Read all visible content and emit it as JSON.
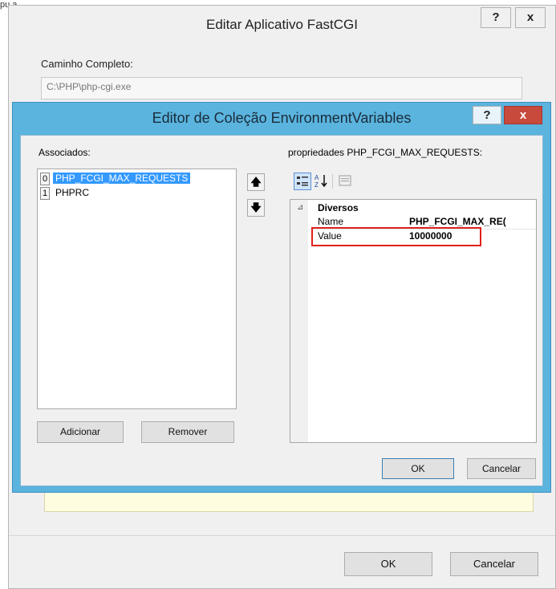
{
  "stray_text": "pu.a ... ... ...",
  "outer": {
    "title": "Editar Aplicativo FastCGI",
    "help_button": "?",
    "close_button": "x",
    "full_path_label": "Caminho Completo:",
    "full_path_value": "C:\\PHP\\php-cgi.exe",
    "ok_label": "OK",
    "cancel_label": "Cancelar"
  },
  "dialog": {
    "title": "Editor de Coleção EnvironmentVariables",
    "help_button": "?",
    "close_button": "x",
    "members_label": "Associados:",
    "members": [
      {
        "index": "0",
        "name": "PHP_FCGI_MAX_REQUESTS",
        "selected": true
      },
      {
        "index": "1",
        "name": "PHPRC",
        "selected": false
      }
    ],
    "move_up_icon": "arrow-up-icon",
    "move_down_icon": "arrow-down-icon",
    "add_label": "Adicionar",
    "remove_label": "Remover",
    "properties_label": "propriedades PHP_FCGI_MAX_REQUESTS:",
    "category_glyph": "⊿",
    "category": "Diversos",
    "properties": [
      {
        "name": "Name",
        "value": "PHP_FCGI_MAX_RE("
      },
      {
        "name": "Value",
        "value": "10000000"
      }
    ],
    "ok_label": "OK",
    "cancel_label": "Cancelar"
  },
  "colors": {
    "dialog_frame": "#5ab4de",
    "selection": "#3399ff",
    "close_red": "#c74a3c",
    "highlight_box": "#e0201a"
  }
}
